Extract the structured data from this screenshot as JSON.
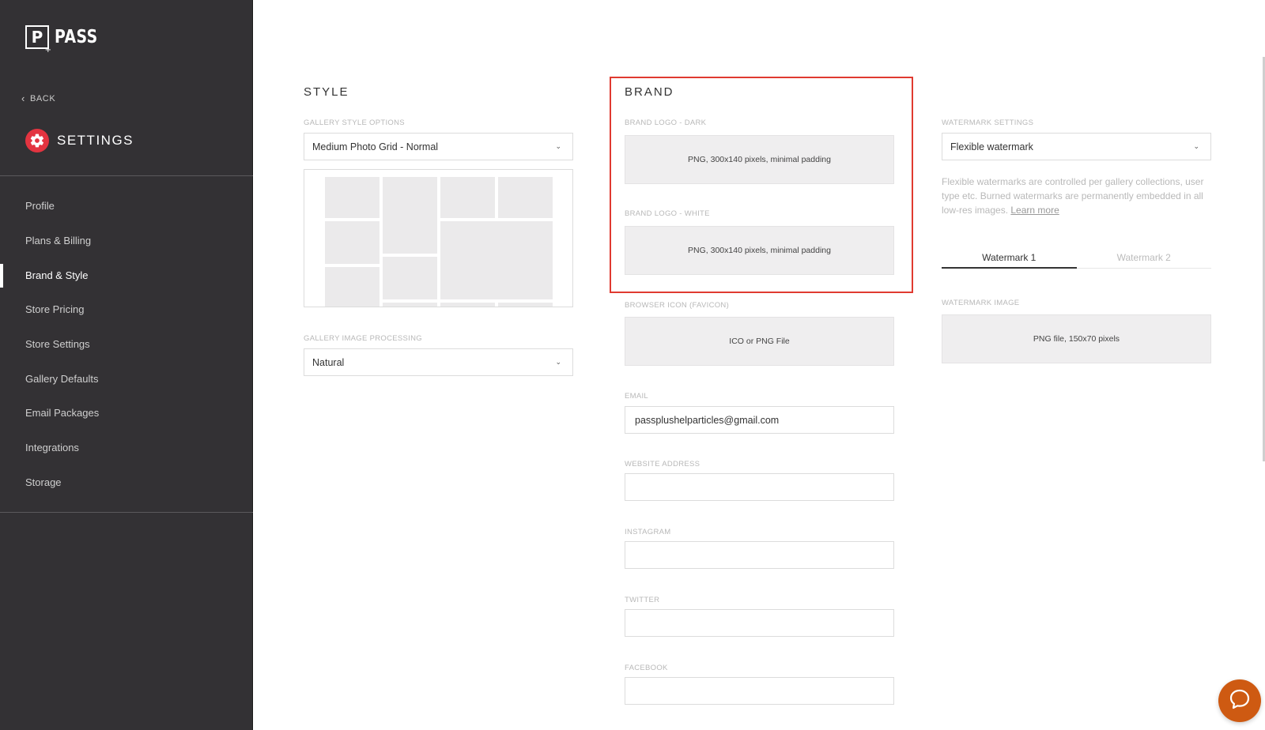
{
  "brand": {
    "logo_letter": "P",
    "logo_text": "PASS"
  },
  "sidebar": {
    "back_label": "BACK",
    "settings_title": "SETTINGS",
    "items": [
      {
        "label": "Profile"
      },
      {
        "label": "Plans & Billing"
      },
      {
        "label": "Brand & Style",
        "active": true
      },
      {
        "label": "Store Pricing"
      },
      {
        "label": "Store Settings"
      },
      {
        "label": "Gallery Defaults"
      },
      {
        "label": "Email Packages"
      },
      {
        "label": "Integrations"
      },
      {
        "label": "Storage"
      }
    ]
  },
  "style": {
    "title": "STYLE",
    "gallery_style_label": "GALLERY STYLE OPTIONS",
    "gallery_style_value": "Medium Photo Grid - Normal",
    "image_processing_label": "GALLERY IMAGE PROCESSING",
    "image_processing_value": "Natural"
  },
  "brand_section": {
    "title": "BRAND",
    "logo_dark_label": "BRAND LOGO - DARK",
    "logo_dark_hint": "PNG, 300x140 pixels, minimal padding",
    "logo_white_label": "BRAND LOGO - WHITE",
    "logo_white_hint": "PNG, 300x140 pixels, minimal padding",
    "favicon_label": "BROWSER ICON (FAVICON)",
    "favicon_hint": "ICO or PNG File",
    "email_label": "EMAIL",
    "email_value": "passplushelparticles@gmail.com",
    "website_label": "WEBSITE ADDRESS",
    "website_value": "",
    "instagram_label": "INSTAGRAM",
    "instagram_value": "",
    "twitter_label": "TWITTER",
    "twitter_value": "",
    "facebook_label": "FACEBOOK",
    "facebook_value": ""
  },
  "watermark": {
    "settings_label": "WATERMARK SETTINGS",
    "settings_value": "Flexible watermark",
    "help_text": "Flexible watermarks are controlled per gallery collections, user type etc. Burned watermarks are permanently embedded in all low-res images.",
    "learn_more": "Learn more",
    "tabs": [
      "Watermark 1",
      "Watermark 2"
    ],
    "image_label": "WATERMARK IMAGE",
    "image_hint": "PNG file, 150x70 pixels"
  },
  "colors": {
    "sidebar_bg": "#333134",
    "accent_red": "#e33440",
    "highlight": "#e03a30",
    "chat": "#ce5a12"
  },
  "icons": {
    "back": "chevron-left-icon",
    "settings": "gear-icon",
    "select": "chevron-down-icon",
    "chat": "chat-bubble-icon"
  }
}
